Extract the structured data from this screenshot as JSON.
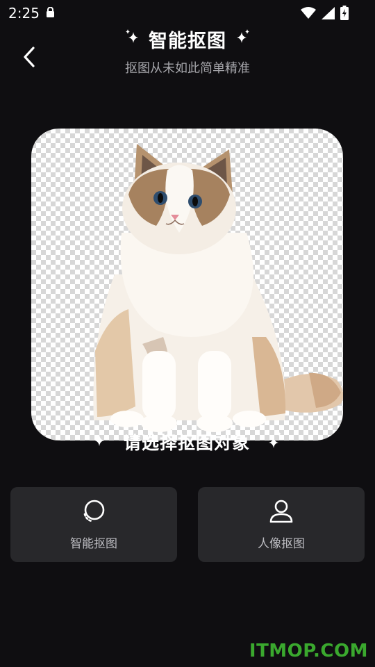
{
  "status_bar": {
    "time": "2:25",
    "icons": [
      "lock-icon",
      "wifi-icon",
      "signal-icon",
      "battery-charging-icon"
    ]
  },
  "header": {
    "title": "智能抠图",
    "subtitle": "抠图从未如此简单精准",
    "back_icon": "chevron-left-icon",
    "sparkle_icon": "sparkle-icon"
  },
  "preview": {
    "image": "cat-cutout-on-transparent-checkerboard"
  },
  "prompt": {
    "text": "请选择抠图对象"
  },
  "modes": [
    {
      "label": "智能抠图",
      "icon": "smart-cutout-circle-icon"
    },
    {
      "label": "人像抠图",
      "icon": "person-icon"
    }
  ],
  "watermark": "ITMOP.COM",
  "colors": {
    "background": "#0f0e11",
    "card": "#28282b",
    "subtitle": "#a6a6ab",
    "watermark": "#3aa82e"
  }
}
